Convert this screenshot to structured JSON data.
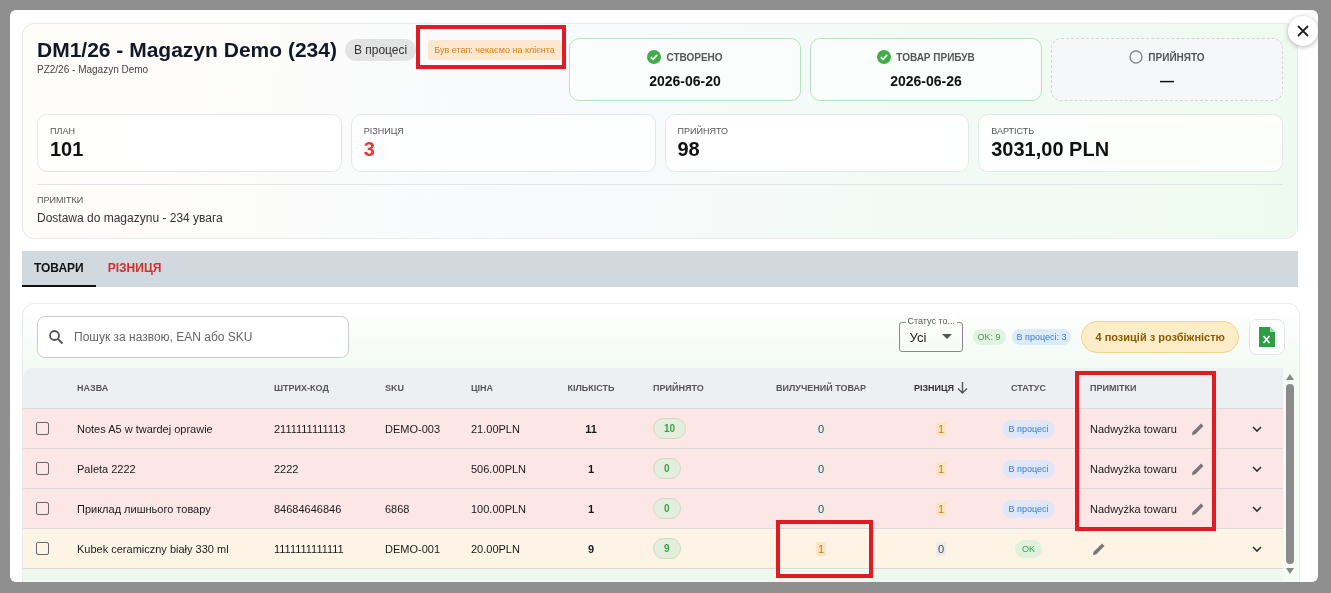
{
  "header": {
    "title": "DM1/26 - Magazyn Demo (234)",
    "status_badge": "В процесі",
    "stage_note": "Був етап: чекаємо на клієнта",
    "subtitle": "PZ2/26 - Magazyn Demo"
  },
  "stages": [
    {
      "label": "СТВОРЕНО",
      "value": "2026-06-20",
      "done": true
    },
    {
      "label": "ТОВАР ПРИБУВ",
      "value": "2026-06-26",
      "done": true
    },
    {
      "label": "ПРИЙНЯТО",
      "value": "—",
      "done": false
    }
  ],
  "stats": [
    {
      "label": "ПЛАН",
      "value": "101",
      "alert": false
    },
    {
      "label": "РІЗНИЦЯ",
      "value": "3",
      "alert": true
    },
    {
      "label": "ПРИЙНЯТО",
      "value": "98",
      "alert": false
    },
    {
      "label": "ВАРТІСТЬ",
      "value": "3031,00 PLN",
      "alert": false
    }
  ],
  "notes": {
    "label": "ПРИМІТКИ",
    "text": "Dostawa do magazynu - 234 увага"
  },
  "tabs": [
    {
      "label": "ТОВАРИ",
      "selected": true,
      "alert": false
    },
    {
      "label": "РІЗНИЦЯ",
      "selected": false,
      "alert": true
    }
  ],
  "toolbar": {
    "search_placeholder": "Пошук за назвою, EAN або SKU",
    "filter_label": "Статус то...",
    "filter_value": "Усі",
    "ok_count": "OK: 9",
    "progress_count": "В процесі: 3",
    "discrepancy": "4 позицій з розбіжністю"
  },
  "table": {
    "columns": [
      {
        "label": "НАЗВА",
        "sorted": false
      },
      {
        "label": "ШТРИХ-КОД",
        "sorted": false
      },
      {
        "label": "SKU",
        "sorted": false
      },
      {
        "label": "ЦІНА",
        "sorted": false
      },
      {
        "label": "КІЛЬКІСТЬ",
        "sorted": false
      },
      {
        "label": "ПРИЙНЯТО",
        "sorted": false
      },
      {
        "label": "ВИЛУЧЕНИЙ ТОВАР",
        "sorted": false
      },
      {
        "label": "РІЗНИЦЯ",
        "sorted": true
      },
      {
        "label": "СТАТУС",
        "sorted": false
      },
      {
        "label": "ПРИМІТКИ",
        "sorted": false
      }
    ],
    "rows": [
      {
        "kind": "surplus",
        "checked": false,
        "name": "Notes A5 w twardej oprawie",
        "barcode": "2111111111113",
        "sku": "DEMO-003",
        "price": "21.00PLN",
        "qty": "11",
        "accepted": "10",
        "removed": {
          "value": "0",
          "highlight": false
        },
        "diff": {
          "value": "1",
          "highlight": true
        },
        "status": {
          "kind": "progress",
          "label": "В процесі"
        },
        "note": "Nadwyżka towaru"
      },
      {
        "kind": "surplus",
        "checked": false,
        "name": "Paleta 2222",
        "barcode": "2222",
        "price": "506.00PLN",
        "qty": "1",
        "accepted": "0",
        "removed": {
          "value": "0",
          "highlight": false
        },
        "diff": {
          "value": "1",
          "highlight": true
        },
        "status": {
          "kind": "progress",
          "label": "В процесі"
        },
        "note": "Nadwyżka towaru"
      },
      {
        "kind": "surplus",
        "checked": false,
        "name": "Приклад лишнього товару",
        "barcode": "84684646846",
        "sku": "6868",
        "price": "100.00PLN",
        "qty": "1",
        "accepted": "0",
        "removed": {
          "value": "0",
          "highlight": false
        },
        "diff": {
          "value": "1",
          "highlight": true
        },
        "status": {
          "kind": "progress",
          "label": "В процесі"
        },
        "note": "Nadwyżka towaru"
      },
      {
        "kind": "removed",
        "checked": false,
        "name": "Kubek ceramiczny biały 330 ml",
        "barcode": "1111111111111",
        "sku": "DEMO-001",
        "price": "20.00PLN",
        "qty": "9",
        "accepted": "9",
        "removed": {
          "value": "1",
          "highlight": true
        },
        "diff": {
          "value": "0",
          "highlight": false
        },
        "status": {
          "kind": "ok",
          "label": "OK"
        }
      }
    ]
  }
}
